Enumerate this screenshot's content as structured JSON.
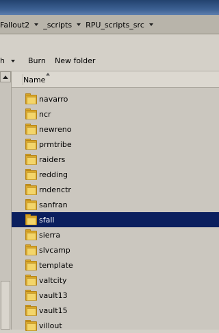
{
  "breadcrumbs": [
    "Fallout2",
    "_scripts",
    "RPU_scripts_src"
  ],
  "toolbar": {
    "partial_label": "h",
    "burn_label": "Burn",
    "new_folder_label": "New folder"
  },
  "header": {
    "name_label": "Name"
  },
  "files": [
    {
      "name": "navarro",
      "selected": false
    },
    {
      "name": "ncr",
      "selected": false
    },
    {
      "name": "newreno",
      "selected": false
    },
    {
      "name": "prmtribe",
      "selected": false
    },
    {
      "name": "raiders",
      "selected": false
    },
    {
      "name": "redding",
      "selected": false
    },
    {
      "name": "rndenctr",
      "selected": false
    },
    {
      "name": "sanfran",
      "selected": false
    },
    {
      "name": "sfall",
      "selected": true
    },
    {
      "name": "sierra",
      "selected": false
    },
    {
      "name": "slvcamp",
      "selected": false
    },
    {
      "name": "template",
      "selected": false
    },
    {
      "name": "valtcity",
      "selected": false
    },
    {
      "name": "vault13",
      "selected": false
    },
    {
      "name": "vault15",
      "selected": false
    },
    {
      "name": "villout",
      "selected": false
    }
  ]
}
